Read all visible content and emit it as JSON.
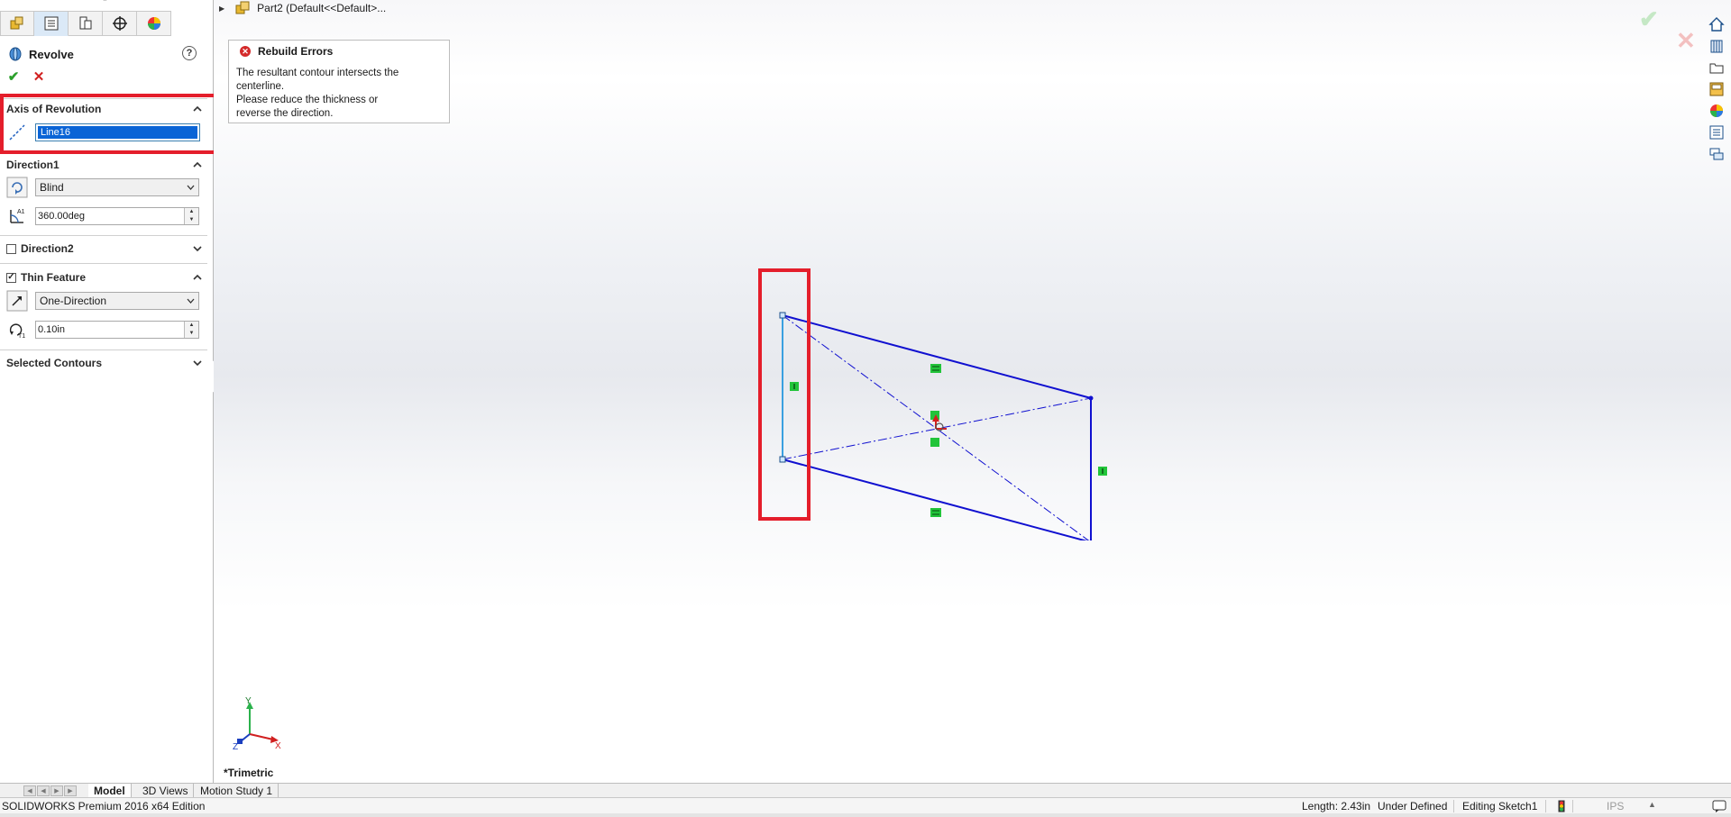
{
  "feature": {
    "title": "Revolve",
    "help_glyph": "?",
    "ok_glyph": "✔",
    "cancel_glyph": "✕"
  },
  "axis_of_revolution": {
    "header": "Axis of Revolution",
    "value": "Line16"
  },
  "direction1": {
    "header": "Direction1",
    "end_condition": "Blind",
    "angle": "360.00deg"
  },
  "direction2": {
    "header": "Direction2",
    "checked": false
  },
  "thin_feature": {
    "header": "Thin Feature",
    "checked": true,
    "check_glyph": "✓",
    "type": "One-Direction",
    "thickness": "0.10in"
  },
  "selected_contours": {
    "header": "Selected Contours"
  },
  "tree": {
    "item": "Part2  (Default<<Default>..."
  },
  "rebuild_errors": {
    "title": "Rebuild Errors",
    "message": "The resultant contour intersects the\ncenterline.\n Please reduce the thickness or\nreverse the direction."
  },
  "viewport": {
    "view_label": "*Trimetric",
    "triad": {
      "x": "X",
      "y": "Y",
      "z": "Z"
    }
  },
  "bottom_tabs": [
    "Model",
    "3D Views",
    "Motion Study 1"
  ],
  "status_bar": {
    "app": "SOLIDWORKS Premium 2016 x64 Edition",
    "length": "Length: 2.43in",
    "definition": "Under Defined",
    "mode": "Editing Sketch1",
    "units": "IPS"
  },
  "colors": {
    "sketch_line": "#1010d0",
    "selected_line": "#3aa0e0",
    "relation_green": "#22c43a",
    "highlight_red": "#e41e2b",
    "selection_blue": "#0a64d6"
  }
}
